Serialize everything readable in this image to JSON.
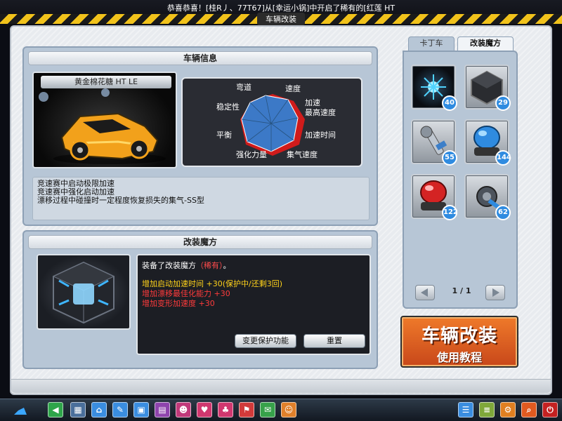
{
  "announcement": "恭喜恭喜！[桂R丿、77T67]从[幸运小锅]中开启了稀有的[红莲 HT",
  "window_title": "车辆改装",
  "vehicle_panel": {
    "title": "车辆信息",
    "car_name": "黄金棉花糖 HT LE",
    "radar": {
      "labels": [
        "弯道",
        "速度",
        "加速",
        "最高速度",
        "加速时间",
        "集气速度",
        "强化力量",
        "平衡",
        "稳定性"
      ]
    },
    "description": [
      "竞速赛中启动极限加速",
      "竞速赛中强化启动加速",
      "漂移过程中碰撞时一定程度恢复损失的集气-SS型"
    ]
  },
  "mod_panel": {
    "title": "改装魔方",
    "equipped_prefix": "装备了改装魔方",
    "equipped_rarity": "（稀有）",
    "equipped_suffix": "。",
    "effects": [
      {
        "text": "增加启动加速时间 +30(保护中/还剩3回)",
        "color": "#ffd21a"
      },
      {
        "text": "增加漂移最佳化能力 +30",
        "color": "#ff3b3b"
      },
      {
        "text": "增加变形加速度 +30",
        "color": "#ff3b3b"
      }
    ],
    "change_protect_button": "变更保护功能",
    "reset_button": "重置"
  },
  "inventory": {
    "tabs": [
      {
        "label": "卡丁车",
        "active": false
      },
      {
        "label": "改装魔方",
        "active": true
      }
    ],
    "items": [
      {
        "icon": "blue-spark-icon",
        "count": "40"
      },
      {
        "icon": "dark-cube-icon",
        "count": "29"
      },
      {
        "icon": "wrench-icon",
        "count": "55"
      },
      {
        "icon": "blue-helmet-icon",
        "count": "144"
      },
      {
        "icon": "red-helmet-icon",
        "count": "122"
      },
      {
        "icon": "gear-wrench-icon",
        "count": "62"
      }
    ],
    "page_indicator": "1 / 1"
  },
  "tutorial": {
    "line1": "车辆改装",
    "line2": "使用教程"
  },
  "taskbar": {
    "icons": [
      "logo-icon",
      "back-arrow-icon",
      "shop-icon",
      "home-icon",
      "tools-icon",
      "card-icon",
      "garage-icon",
      "character-icon",
      "heart-icon",
      "team-icon",
      "flag-icon",
      "mail-icon",
      "friends-icon",
      "notes-icon",
      "settings-icon",
      "search-icon",
      "power-icon"
    ]
  }
}
